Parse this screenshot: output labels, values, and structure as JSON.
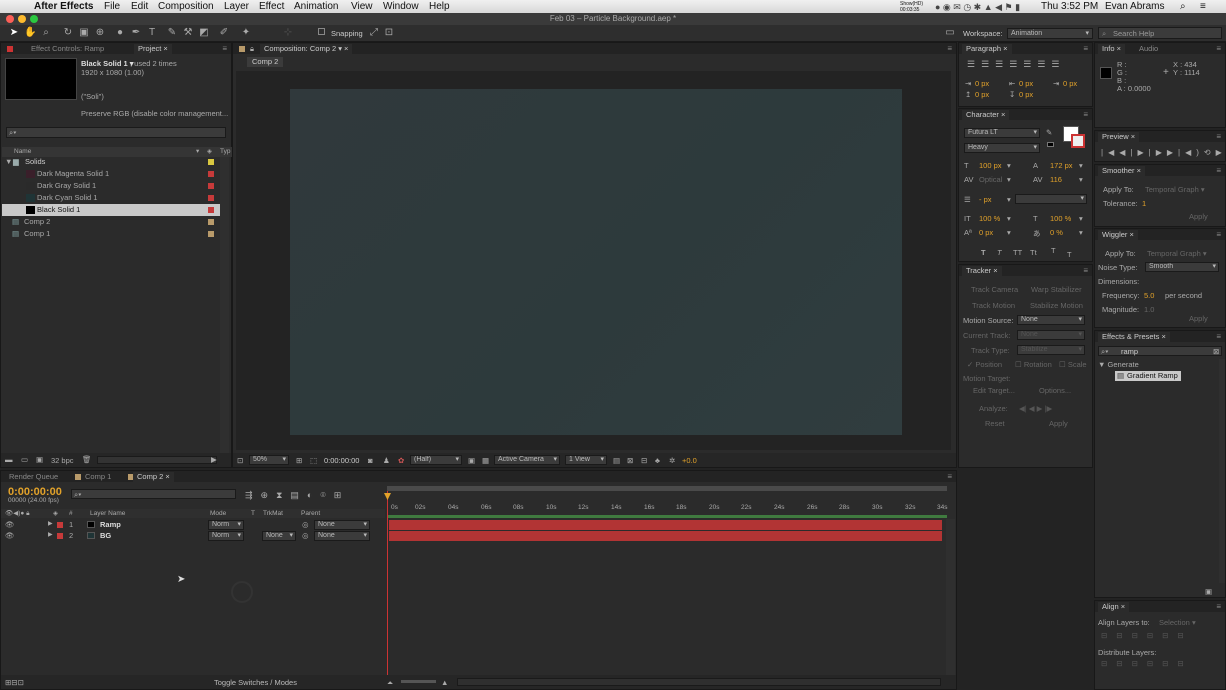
{
  "menubar": {
    "apple": "",
    "app": "After Effects",
    "items": [
      "File",
      "Edit",
      "Composition",
      "Layer",
      "Effect",
      "Animation",
      "View",
      "Window",
      "Help"
    ],
    "clock": "Thu 3:52 PM",
    "user": "Evan Abrams",
    "show_hd": "Show(HD)",
    "timer": "00:03:35"
  },
  "document_title": "Feb 03 – Particle Background.aep *",
  "toolbar": {
    "snapping_label": "Snapping",
    "workspace_label": "Workspace:",
    "workspace_value": "Animation",
    "search_placeholder": "Search Help"
  },
  "project": {
    "tabs": [
      "Effect Controls: Ramp",
      "Project"
    ],
    "item_name": "Black Solid 1 ▾",
    "item_used": ", used 2 times",
    "item_size": "1920 x 1080 (1.00)",
    "item_type": "(\"Soli\")",
    "preserve": "Preserve RGB (disable color management...",
    "col_name": "Name",
    "col_type": "Typ",
    "rows": [
      {
        "label": "Solids",
        "color": "#d9c740"
      },
      {
        "label": "Dark Magenta Solid 1",
        "color": "#c63a3a"
      },
      {
        "label": "Dark Gray Solid 1",
        "color": "#c63a3a"
      },
      {
        "label": "Dark Cyan Solid 1",
        "color": "#c63a3a"
      },
      {
        "label": "Black Solid 1",
        "color": "#c63a3a"
      },
      {
        "label": "Comp 2",
        "color": "#b89a6a"
      },
      {
        "label": "Comp 1",
        "color": "#b89a6a"
      }
    ],
    "bpc": "32 bpc"
  },
  "comp": {
    "tab": "Composition: Comp 2",
    "crumb": "Comp 2",
    "zoom": "50%",
    "time": "0:00:00:00",
    "resolution": "(Half)",
    "camera": "Active Camera",
    "view": "1 View",
    "exposure": "+0.0",
    "bg_color": "#2f3b3d"
  },
  "paragraph": {
    "tab": "Paragraph",
    "indents": [
      "0 px",
      "0 px",
      "0 px",
      "0 px",
      "0 px"
    ]
  },
  "character": {
    "tab": "Character",
    "font": "Futura LT",
    "style": "Heavy",
    "size": "100 px",
    "leading": "172 px",
    "kerning": "Optical",
    "tracking": "116",
    "stroke": "- px",
    "vscale": "100 %",
    "hscale": "100 %",
    "baseline": "0 px",
    "tsume": "0 %",
    "styles": [
      "T",
      "T",
      "TT",
      "Tt",
      "T",
      "T"
    ]
  },
  "tracker": {
    "tab": "Tracker",
    "track_camera": "Track Camera",
    "warp_stabilizer": "Warp Stabilizer",
    "track_motion": "Track Motion",
    "stabilize_motion": "Stabilize Motion",
    "motion_source_label": "Motion Source:",
    "motion_source": "None",
    "current_track_label": "Current Track:",
    "current_track": "None",
    "track_type_label": "Track Type:",
    "track_type": "Stabilize",
    "position": "Position",
    "rotation": "Rotation",
    "scale": "Scale",
    "motion_target": "Motion Target:",
    "edit_target": "Edit Target...",
    "options": "Options...",
    "analyze": "Analyze:",
    "reset": "Reset",
    "apply": "Apply"
  },
  "info": {
    "tabs": [
      "Info",
      "Audio"
    ],
    "r": "R :",
    "g": "G :",
    "b": "B :",
    "a": "A : 0.0000",
    "x": "X : 434",
    "y": "Y : 1114"
  },
  "preview": {
    "tab": "Preview"
  },
  "smoother": {
    "tab": "Smoother",
    "apply_to_label": "Apply To:",
    "apply_to": "Temporal Graph",
    "tolerance_label": "Tolerance:",
    "tolerance": "1",
    "apply": "Apply"
  },
  "wiggler": {
    "tab": "Wiggler",
    "apply_to_label": "Apply To:",
    "apply_to": "Temporal Graph",
    "noise_label": "Noise Type:",
    "noise": "Smooth",
    "dimensions_label": "Dimensions:",
    "frequency_label": "Frequency:",
    "frequency": "5.0",
    "frequency_unit": "per second",
    "magnitude_label": "Magnitude:",
    "magnitude": "1.0",
    "apply": "Apply"
  },
  "effects": {
    "tab": "Effects & Presets",
    "search": "ramp",
    "category": "Generate",
    "item": "Gradient Ramp"
  },
  "align": {
    "tab": "Align",
    "align_to_label": "Align Layers to:",
    "align_to": "Selection",
    "distribute": "Distribute Layers:"
  },
  "timeline": {
    "tabs": [
      "Render Queue",
      "Comp 1",
      "Comp 2"
    ],
    "timecode": "0:00:00:00",
    "frames": "00000 (24.00 fps)",
    "cols": {
      "num": "#",
      "name": "Layer Name",
      "mode": "Mode",
      "t": "T",
      "trkmat": "TrkMat",
      "parent": "Parent"
    },
    "layers": [
      {
        "num": "1",
        "name": "Ramp",
        "mode": "Norm",
        "trkmat": "",
        "parent": "None"
      },
      {
        "num": "2",
        "name": "BG",
        "mode": "Norm",
        "trkmat": "None",
        "parent": "None"
      }
    ],
    "ruler": [
      "0s",
      "02s",
      "04s",
      "06s",
      "08s",
      "10s",
      "12s",
      "14s",
      "16s",
      "18s",
      "20s",
      "22s",
      "24s",
      "26s",
      "28s",
      "30s",
      "32s",
      "34s"
    ],
    "toggle": "Toggle Switches / Modes"
  }
}
